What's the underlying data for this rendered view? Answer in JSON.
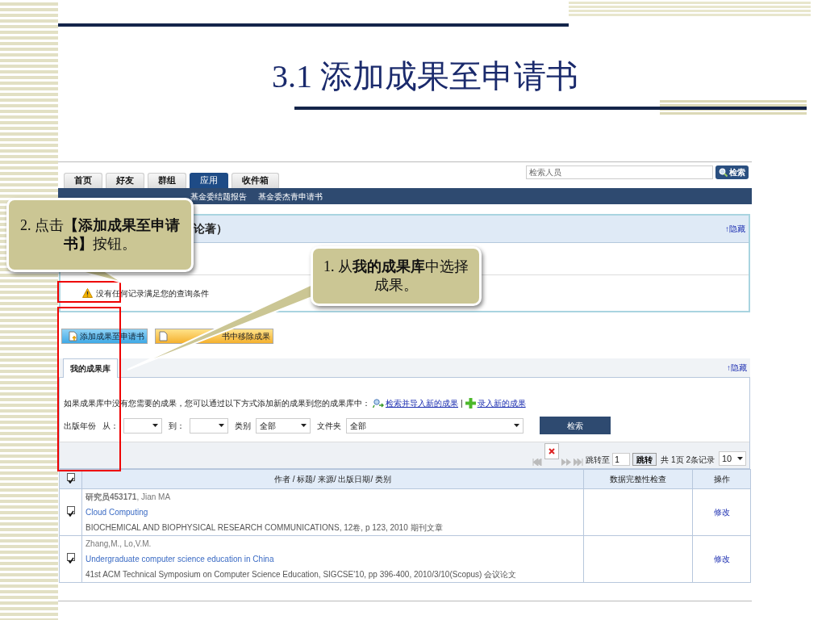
{
  "slide_title": "3.1  添加成果至申请书",
  "top_tabs": [
    {
      "label": "首页",
      "selected": false
    },
    {
      "label": "好友",
      "selected": false
    },
    {
      "label": "群组",
      "selected": false
    },
    {
      "label": "应用",
      "selected": true
    },
    {
      "label": "收件箱",
      "selected": false
    }
  ],
  "search": {
    "placeholder": "检索人员",
    "button": "检索"
  },
  "sub_nav": [
    "基金委结题报告",
    "基金委杰青申请书"
  ],
  "selected_section": {
    "title": "论著）",
    "hide_link": "↑隐藏",
    "message": "没有任何记录满足您的查询条件"
  },
  "action_buttons": [
    {
      "label": "添加成果至申请书",
      "kind": "add"
    },
    {
      "label": "书中移除成果",
      "kind": "remove"
    }
  ],
  "library": {
    "tab": "我的成果库",
    "hide_link": "↑隐藏",
    "hint": "如果成果库中没有您需要的成果，您可以通过以下方式添加新的成果到您的成果库中：",
    "links": [
      {
        "label": "检索并导入新的成果",
        "kind": "search"
      },
      {
        "label": "录入新的成果",
        "kind": "add"
      }
    ],
    "link_separator": "|",
    "filter_label": "出版年份",
    "filters": [
      {
        "label": "从：",
        "kind": "short"
      },
      {
        "label": "到：",
        "kind": "short"
      },
      {
        "label": "类别",
        "kind": "medium",
        "value": "全部"
      },
      {
        "label": "文件夹",
        "kind": "wide",
        "value": "全部"
      }
    ],
    "filter_button": "检索"
  },
  "pager": {
    "jump_label": "跳转至",
    "page": "1",
    "jump_button": "跳转",
    "summary": "共 1页 2条记录",
    "page_size": "10"
  },
  "table": {
    "all_checked": true,
    "columns": [
      "作者 / 标题/ 来源/ 出版日期/ 类别",
      "数据完整性检查",
      "操作"
    ],
    "rows": [
      {
        "checked": true,
        "authors": "**研究员453171**, Jian MA",
        "title": "Cloud Computing",
        "source": "BIOCHEMICAL AND BIOPHYSICAL RESEARCH COMMUNICATIONS, 12卷, p 123, 2010 期刊文章",
        "action": "修改"
      },
      {
        "checked": true,
        "authors": "Zhang,M., Lo,V.M.",
        "title": "Undergraduate computer science education in China",
        "source": "41st ACM Technical Symposium on Computer Science Education, SIGCSE'10, pp 396-400, 2010/3/10(Scopus) 会议论文",
        "action": "修改"
      }
    ]
  },
  "callouts": [
    {
      "text": "2.  点击**【添加成果至申请书】**按钮。",
      "kind": "left"
    },
    {
      "text": "1.  从**我的成果库**中选择成果。",
      "kind": "right"
    }
  ]
}
